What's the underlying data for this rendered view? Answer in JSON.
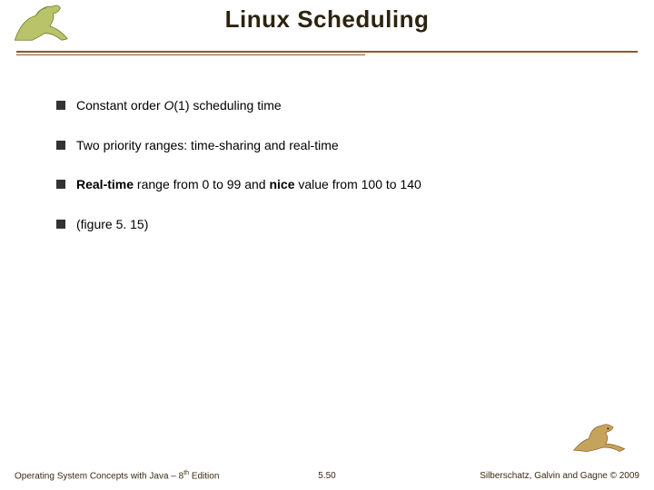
{
  "header": {
    "title": "Linux Scheduling"
  },
  "bullets": [
    {
      "pre": "Constant order ",
      "emph": "O",
      "emph_style": "it",
      "post": "(1) scheduling time"
    },
    {
      "pre": "Two priority ranges: time-sharing and real-time",
      "emph": "",
      "emph_style": "",
      "post": ""
    },
    {
      "pre": "",
      "emph": "Real-time",
      "emph_style": "b",
      "mid": " range from 0 to 99 and ",
      "emph2": "nice",
      "emph2_style": "b",
      "post": " value from 100 to 140"
    },
    {
      "pre": "(figure 5. 15)",
      "emph": "",
      "emph_style": "",
      "post": ""
    }
  ],
  "footer": {
    "left_pre": "Operating System Concepts with Java – 8",
    "left_sup": "th",
    "left_post": " Edition",
    "page": "5.50",
    "right": "Silberschatz, Galvin and Gagne © 2009"
  },
  "icons": {
    "dino_header": "dinosaur-icon",
    "dino_footer": "dinosaur-icon"
  }
}
